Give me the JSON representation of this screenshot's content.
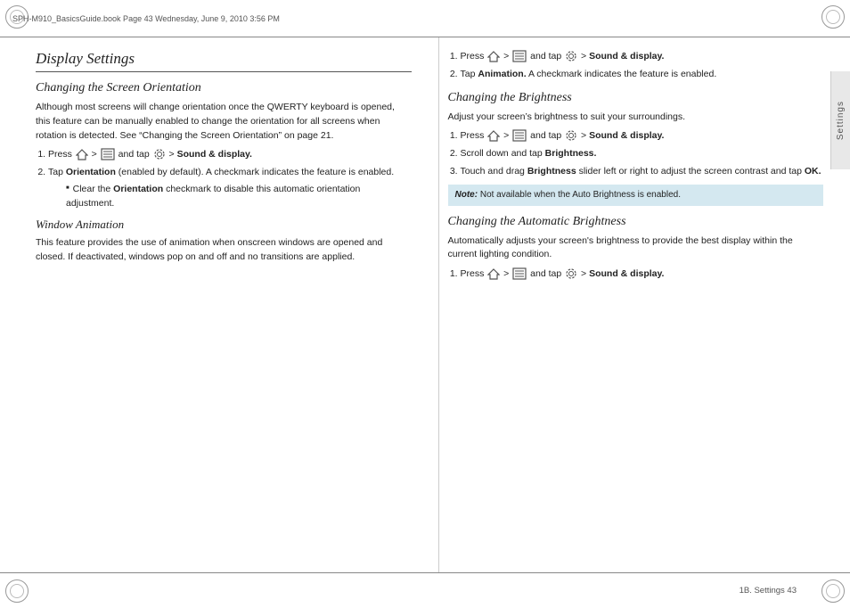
{
  "header": {
    "label": "SPH-M910_BasicsGuide.book  Page 43  Wednesday, June 9, 2010  3:56 PM"
  },
  "footer": {
    "page_info": "1B. Settings        43"
  },
  "settings_tab": "Settings",
  "left_col": {
    "page_title": "Display Settings",
    "section1": {
      "title": "Changing the Screen Orientation",
      "body": "Although most screens will change orientation once the QWERTY keyboard is opened, this feature can be manually enabled to change the orientation for all screens when rotation is detected. See “Changing the Screen Orientation” on page 21.",
      "steps": [
        {
          "id": 1,
          "text_pre": "Press",
          "icon_home": true,
          "text_arrow": ">",
          "icon_menu": true,
          "text_mid": "and tap",
          "icon_gear": true,
          "text_post": "> Sound & display."
        },
        {
          "id": 2,
          "text": "Tap Orientation (enabled by default). A checkmark indicates the feature is enabled."
        }
      ],
      "bullet": "Clear the Orientation checkmark to disable this automatic orientation adjustment."
    },
    "section2": {
      "title": "Window Animation",
      "body": "This feature provides the use of animation when onscreen windows are opened and closed. If deactivated, windows pop on and off and no transitions are applied."
    }
  },
  "right_col": {
    "steps_window_anim": [
      {
        "id": 1,
        "text_pre": "Press",
        "icon_home": true,
        "text_arrow": ">",
        "icon_menu": true,
        "text_mid": "and tap",
        "icon_gear": true,
        "text_post": "> Sound & display."
      },
      {
        "id": 2,
        "text": "Tap Animation. A checkmark indicates the feature is enabled."
      }
    ],
    "section1": {
      "title": "Changing the Brightness",
      "body": "Adjust your screen’s brightness to suit your surroundings.",
      "steps": [
        {
          "id": 1,
          "text_pre": "Press",
          "icon_home": true,
          "text_arrow": ">",
          "icon_menu": true,
          "text_mid": "and tap",
          "icon_gear": true,
          "text_post": "> Sound & display."
        },
        {
          "id": 2,
          "text": "Scroll down and tap Brightness."
        },
        {
          "id": 3,
          "text": "Touch and drag Brightness slider left or right to adjust the screen contrast and tap OK."
        }
      ],
      "note": "Not available when the Auto Brightness is enabled."
    },
    "section2": {
      "title": "Changing the Automatic Brightness",
      "body": "Automatically adjusts your screen's brightness to provide the best display within the current lighting condition.",
      "steps": [
        {
          "id": 1,
          "text_pre": "Press",
          "icon_home": true,
          "text_arrow": ">",
          "icon_menu": true,
          "text_mid": "and tap",
          "icon_gear": true,
          "text_post": "> Sound & display."
        }
      ]
    }
  }
}
